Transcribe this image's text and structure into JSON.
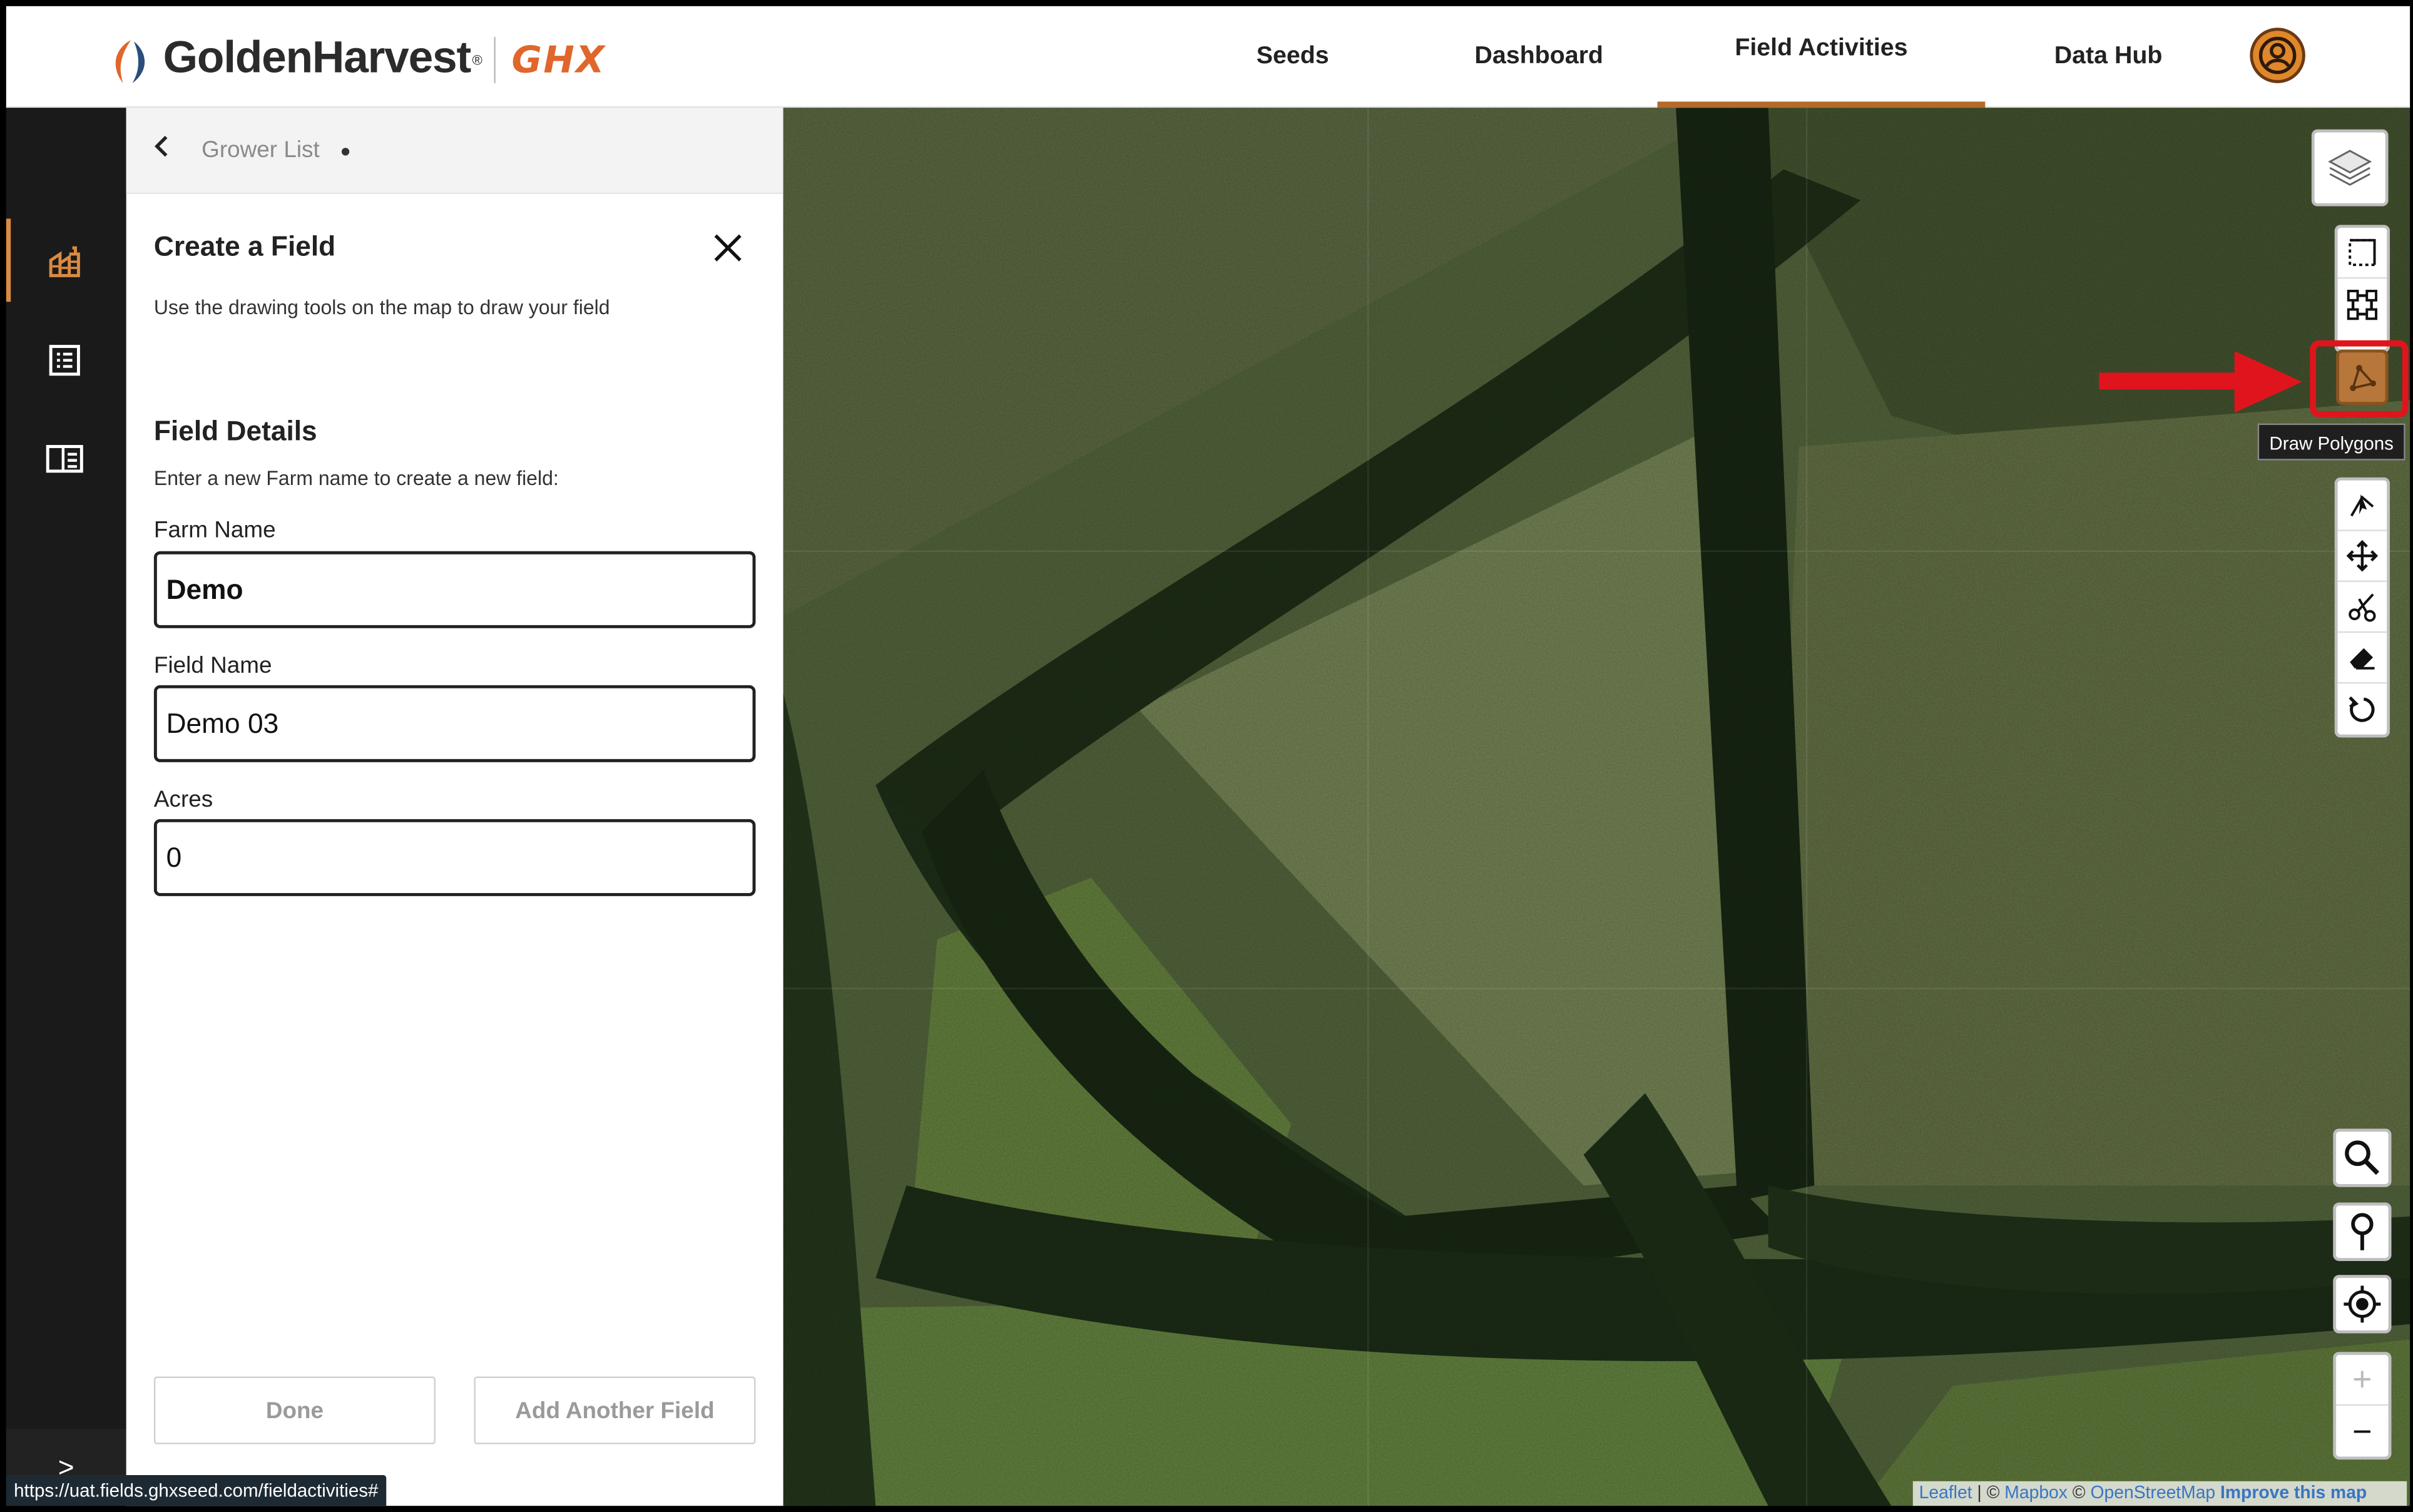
{
  "app": {
    "brand": "GoldenHarvest",
    "brand_mark": "®",
    "sub_brand": "GHX"
  },
  "nav": {
    "items": [
      {
        "label": "Seeds"
      },
      {
        "label": "Dashboard"
      },
      {
        "label": "Field Activities",
        "active": true
      },
      {
        "label": "Data Hub"
      }
    ],
    "avatar_icon": "user-circle-icon"
  },
  "rail": {
    "items": [
      "farm-icon",
      "list-icon",
      "panel-icon"
    ],
    "expand_glyph": ">"
  },
  "panel": {
    "breadcrumb": "Grower List",
    "title": "Create a Field",
    "description": "Use the drawing tools on the map to draw your field",
    "section_title": "Field Details",
    "section_description": "Enter a new Farm name to create a new field:",
    "fields": [
      {
        "label": "Farm Name",
        "value": "Demo"
      },
      {
        "label": "Field Name",
        "value": "Demo 03"
      },
      {
        "label": "Acres",
        "value": "0"
      }
    ],
    "buttons": {
      "done": "Done",
      "add_another": "Add Another Field"
    }
  },
  "status_url": "https://uat.fields.ghxseed.com/fieldactivities#",
  "map": {
    "tooltip": "Draw Polygons",
    "draw_tools": [
      "rectangle-select-icon",
      "polygon-vertex-icon",
      "draw-polygon-icon"
    ],
    "edit_tools": [
      "edit-vertex-icon",
      "move-icon",
      "cut-icon",
      "eraser-icon",
      "rotate-icon"
    ],
    "side_tools": [
      "search-icon",
      "pin-icon",
      "locate-icon"
    ],
    "zoom_in": "+",
    "zoom_out": "−",
    "attribution": {
      "leaflet": "Leaflet",
      "sep1": " | © ",
      "mapbox": "Mapbox",
      "sep2": " © ",
      "osm": "OpenStreetMap",
      "improve": "Improve this map"
    },
    "colors": {
      "active_tool": "#b8773a",
      "highlight": "#e0141c",
      "arrow": "#e0141c"
    }
  }
}
